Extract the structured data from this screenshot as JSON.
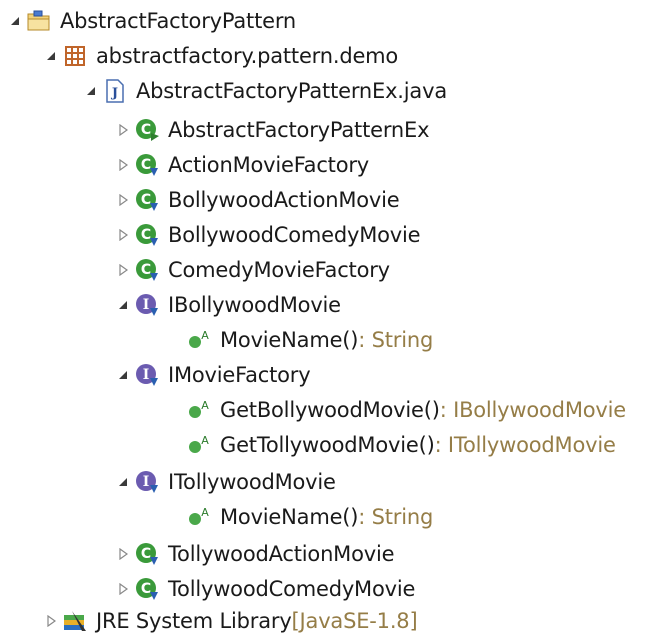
{
  "tree": {
    "project": {
      "label": "AbstractFactoryPattern"
    },
    "package": {
      "label": "abstractfactory.pattern.demo"
    },
    "file": {
      "label": "AbstractFactoryPatternEx.java"
    },
    "classes": {
      "c1": "AbstractFactoryPatternEx",
      "c2": "ActionMovieFactory",
      "c3": "BollywoodActionMovie",
      "c4": "BollywoodComedyMovie",
      "c5": "ComedyMovieFactory",
      "c6": "TollywoodActionMovie",
      "c7": "TollywoodComedyMovie"
    },
    "interfaces": {
      "i1": {
        "label": "IBollywoodMovie",
        "m1": {
          "name": "MovieName()",
          "type": " : String"
        }
      },
      "i2": {
        "label": "IMovieFactory",
        "m1": {
          "name": "GetBollywoodMovie()",
          "type": " : IBollywoodMovie"
        },
        "m2": {
          "name": "GetTollywoodMovie()",
          "type": " : ITollywoodMovie"
        }
      },
      "i3": {
        "label": "ITollywoodMovie",
        "m1": {
          "name": "MovieName()",
          "type": " : String"
        }
      }
    },
    "library": {
      "label": "JRE System Library",
      "suffix": " [JavaSE-1.8]"
    }
  },
  "colors": {
    "class_icon": "#3a9a3a",
    "interface_icon": "#6b5bb0",
    "method_icon": "#4aa84a",
    "type_text": "#957d47",
    "package_icon": "#c0652a"
  },
  "icons": {
    "expanded": "triangle-down-icon",
    "collapsed": "triangle-right-icon",
    "project": "project-folder-icon",
    "package": "package-icon",
    "file": "java-file-icon",
    "class": "class-icon",
    "interface": "interface-icon",
    "method": "abstract-method-icon",
    "library": "library-icon"
  }
}
